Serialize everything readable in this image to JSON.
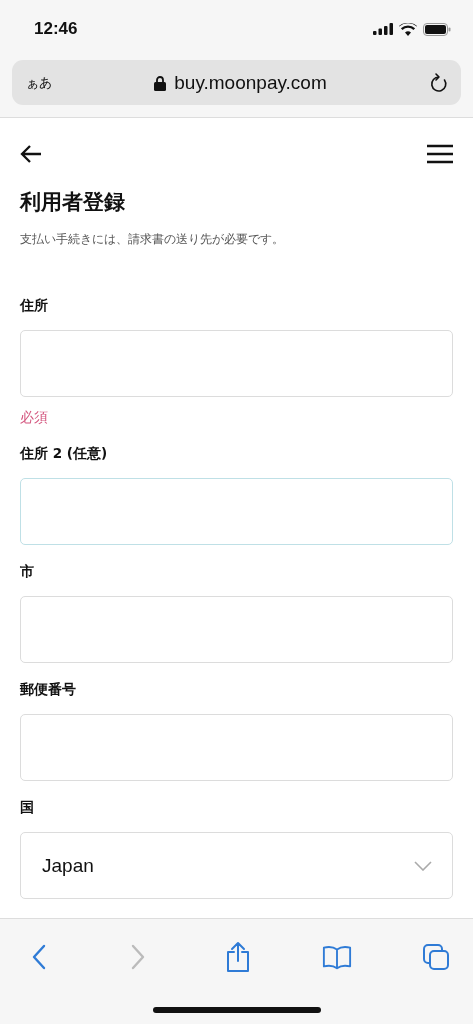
{
  "status_bar": {
    "time": "12:46"
  },
  "address_bar": {
    "text_size_button": "ぁあ",
    "url": "buy.moonpay.com"
  },
  "page": {
    "title": "利用者登録",
    "subtitle": "支払い手続きには、請求書の送り先が必要です。",
    "fields": [
      {
        "label": "住所",
        "kind": "text",
        "focused": false,
        "error": "必須"
      },
      {
        "label": "住所 2 (任意)",
        "kind": "text",
        "focused": true
      },
      {
        "label": "市",
        "kind": "text",
        "focused": false
      },
      {
        "label": "郵便番号",
        "kind": "text",
        "focused": false
      },
      {
        "label": "国",
        "kind": "select",
        "focused": false,
        "value": "Japan"
      }
    ]
  },
  "toolbar": [
    {
      "kind": "back",
      "disabled": false
    },
    {
      "kind": "forward",
      "disabled": true
    },
    {
      "kind": "share",
      "disabled": false
    },
    {
      "kind": "bookmarks",
      "disabled": false
    },
    {
      "kind": "tabs",
      "disabled": false
    }
  ]
}
